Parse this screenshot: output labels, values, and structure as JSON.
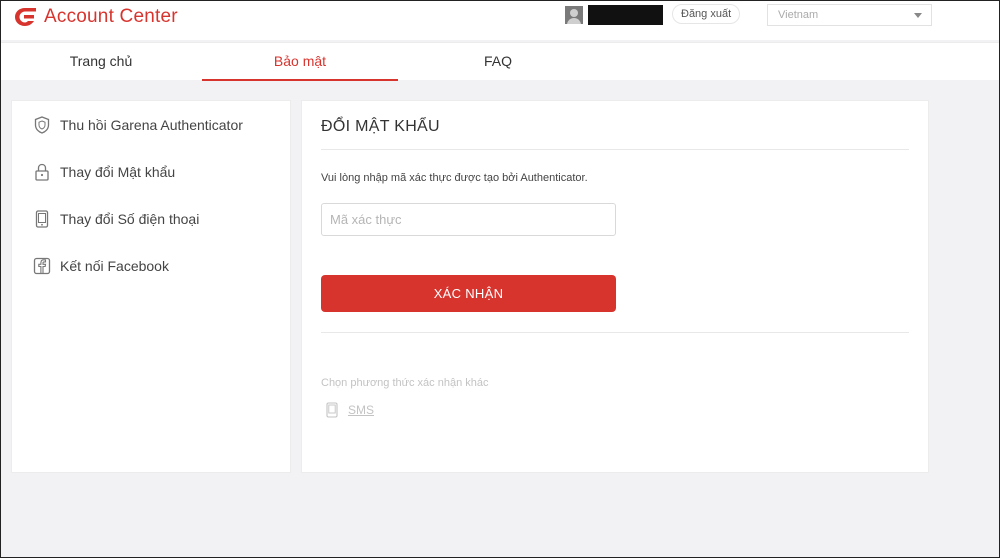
{
  "header": {
    "brand": "Account Center",
    "logout_label": "Đăng xuất",
    "language": "Vietnam"
  },
  "nav": {
    "tabs": [
      {
        "label": "Trang chủ",
        "active": false
      },
      {
        "label": "Bảo mật",
        "active": true
      },
      {
        "label": "FAQ",
        "active": false
      }
    ]
  },
  "sidebar": {
    "items": [
      {
        "label": "Thu hồi Garena Authenticator",
        "icon": "shield-icon"
      },
      {
        "label": "Thay đổi Mật khẩu",
        "icon": "lock-icon"
      },
      {
        "label": "Thay đổi Số điện thoại",
        "icon": "phone-icon"
      },
      {
        "label": "Kết nối Facebook",
        "icon": "facebook-icon"
      }
    ]
  },
  "main": {
    "title": "ĐỔI MẬT KHẨU",
    "instruction": "Vui lòng nhập mã xác thực được tạo bởi Authenticator.",
    "code_input": {
      "placeholder": "Mã xác thực",
      "value": ""
    },
    "confirm_label": "XÁC NHẬN",
    "alt_methods_label": "Chọn phương thức xác nhận khác",
    "sms_label": "SMS"
  },
  "colors": {
    "accent": "#d8342e",
    "background": "#f2f2f4"
  }
}
